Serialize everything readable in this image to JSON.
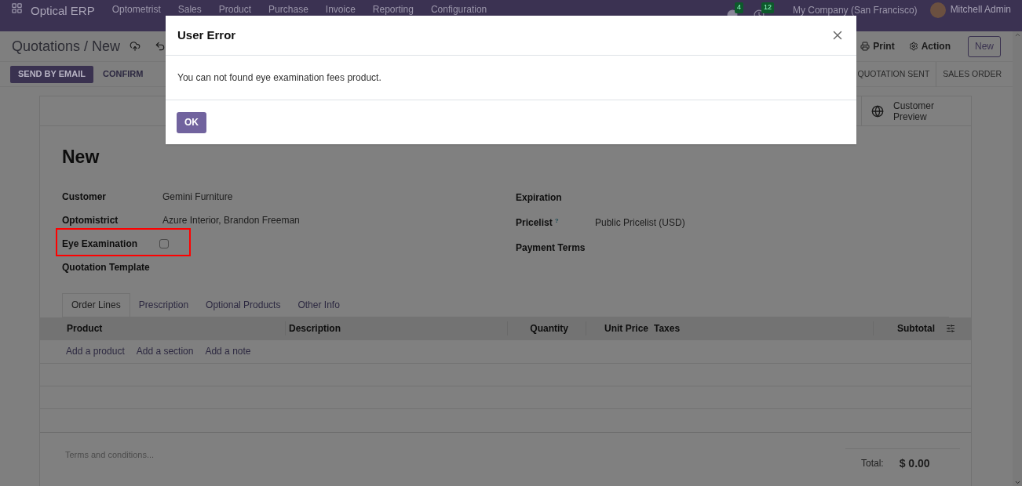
{
  "navbar": {
    "app_name": "Optical ERP",
    "menu": [
      "Optometrist",
      "Sales",
      "Product",
      "Purchase",
      "Invoice",
      "Reporting",
      "Configuration"
    ],
    "messages_count": "4",
    "activities_count": "12",
    "company": "My Company (San Francisco)",
    "user": "Mitchell Admin"
  },
  "breadcrumb": "Quotations / New",
  "actions": {
    "print": "Print",
    "action": "Action",
    "new": "New"
  },
  "buttons": [
    {
      "label": "SEND BY EMAIL",
      "primary": true
    },
    {
      "label": "CONFIRM",
      "primary": false
    }
  ],
  "status_bar": [
    {
      "label": "QUOTATION SENT",
      "selected": false
    },
    {
      "label": "SALES ORDER",
      "selected": false
    }
  ],
  "smart_button": "Customer Preview",
  "title": "New",
  "left_fields": [
    {
      "kind": "text",
      "label": "Customer",
      "value": "Gemini Furniture",
      "highlighted": false
    },
    {
      "kind": "text",
      "label": "Optomistrict",
      "value": "Azure Interior, Brandon Freeman",
      "highlighted": false
    },
    {
      "kind": "checkbox",
      "label": "Eye Examination",
      "checked": false,
      "highlighted": true
    },
    {
      "kind": "text",
      "label": "Quotation Template",
      "highlighted": false
    }
  ],
  "right_fields": [
    {
      "label": "Expiration"
    },
    {
      "label": "Pricelist",
      "help": "?",
      "value": "Public Pricelist (USD)"
    },
    {
      "label": "Payment Terms"
    }
  ],
  "tabs": [
    {
      "label": "Order Lines",
      "selected": true
    },
    {
      "label": "Prescription",
      "selected": false
    },
    {
      "label": "Optional Products",
      "selected": false
    },
    {
      "label": "Other Info",
      "selected": false
    }
  ],
  "table": {
    "columns": [
      "Product",
      "Description",
      "Quantity",
      "Unit Price",
      "Taxes",
      "Subtotal"
    ],
    "add_links": [
      "Add a product",
      "Add a section",
      "Add a note"
    ]
  },
  "terms_placeholder": "Terms and conditions...",
  "total": {
    "label": "Total:",
    "value": "$ 0.00"
  },
  "dialog": {
    "title": "User Error",
    "message": "You can not found eye examination fees product.",
    "button": "OK"
  }
}
